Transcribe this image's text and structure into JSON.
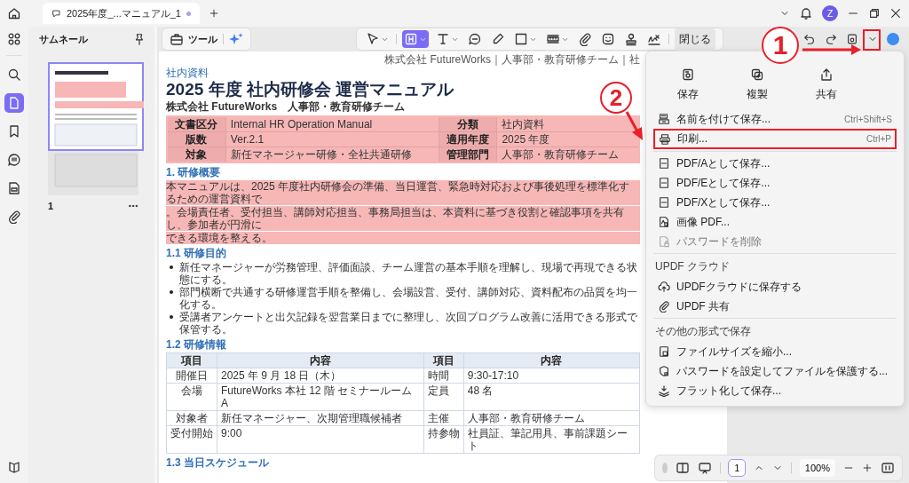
{
  "tab": {
    "title": "2025年度_...マニュアル_1",
    "modified": true
  },
  "account": {
    "initial": "Z"
  },
  "rail": [
    {
      "selected": false
    },
    {
      "selected": true
    },
    {
      "selected": false
    },
    {
      "selected": false
    },
    {
      "selected": false
    },
    {
      "selected": false
    }
  ],
  "thumbnails": {
    "title": "サムネール",
    "pages": [
      {
        "number": "1",
        "selected": true
      }
    ]
  },
  "tools_button": {
    "label": "ツール"
  },
  "toolbar": {
    "tools": [
      {
        "selected": false,
        "dropdown": true
      },
      {
        "selected": true,
        "dropdown": true
      },
      {
        "selected": false,
        "dropdown": true
      },
      {
        "selected": false,
        "dropdown": false
      },
      {
        "selected": false,
        "dropdown": false
      },
      {
        "selected": false,
        "dropdown": true
      },
      {
        "selected": false,
        "dropdown": true
      },
      {
        "selected": false,
        "dropdown": false
      },
      {
        "selected": false,
        "dropdown": false
      },
      {
        "selected": false,
        "dropdown": false
      },
      {
        "selected": false,
        "dropdown": false
      }
    ],
    "close_label": "閉じる"
  },
  "document": {
    "header": "株式会社 FutureWorks｜人事部・教育研修チーム｜社",
    "label": "社内資料",
    "title": "2025 年度 社内研修会 運営マニュアル",
    "org": "株式会社 FutureWorks　人事部・教育研修チーム",
    "meta_rows": [
      [
        "文書区分",
        "Internal HR Operation Manual",
        "分類",
        "社内資料"
      ],
      [
        "版数",
        "Ver.2.1",
        "適用年度",
        "2025 年度"
      ],
      [
        "対象",
        "新任マネージャー研修・全社共通研修",
        "管理部門",
        "人事部・教育研修チーム"
      ]
    ],
    "overview": {
      "heading": "1. 研修概要",
      "highlighted": true,
      "lines": [
        "本マニュアルは、2025 年度社内研修会の準備、当日運営、緊急時対応および事後処理を標準化するための運営資料で",
        "。会場責任者、受付担当、講師対応担当、事務局担当は、本資料に基づき役割と確認事項を共有し、参加者が円滑に",
        "できる環境を整える。"
      ]
    },
    "purpose": {
      "heading": "1.1 研修目的",
      "bullets": [
        "新任マネージャーが労務管理、評価面談、チーム運営の基本手順を理解し、現場で再現できる状態にする。",
        "部門横断で共通する研修運営手順を整備し、会場設営、受付、講師対応、資料配布の品質を均一化する。",
        "受講者アンケートと出欠記録を翌営業日までに整理し、次回プログラム改善に活用できる形式で保管する。"
      ]
    },
    "info": {
      "heading": "1.2 研修情報",
      "columns": [
        "項目",
        "内容",
        "項目",
        "内容"
      ],
      "rows": [
        [
          "開催日",
          "2025 年 9 月 18 日（木）",
          "時間",
          "9:30-17:10"
        ],
        [
          "会場",
          "FutureWorks 本社 12 階 セミナールーム A",
          "定員",
          "48 名"
        ],
        [
          "対象者",
          "新任マネージャー、次期管理職候補者",
          "主催",
          "人事部・教育研修チーム"
        ],
        [
          "受付開始",
          "9:00",
          "持参物",
          "社員証、筆記用具、事前課題シート"
        ]
      ]
    },
    "schedule": {
      "heading": "1.3 当日スケジュール"
    }
  },
  "menu": {
    "quick_actions": [
      {
        "label": "保存"
      },
      {
        "label": "複製"
      },
      {
        "label": "共有"
      }
    ],
    "sections": [
      {
        "items": [
          {
            "label": "名前を付けて保存...",
            "shortcut": "Ctrl+Shift+S",
            "disabled": false,
            "marked": false
          },
          {
            "label": "印刷...",
            "shortcut": "Ctrl+P",
            "disabled": false,
            "marked": true
          }
        ]
      },
      {
        "items": [
          {
            "label": "PDF/Aとして保存...",
            "disabled": false,
            "marked": false
          },
          {
            "label": "PDF/Eとして保存...",
            "disabled": false,
            "marked": false
          },
          {
            "label": "PDF/Xとして保存...",
            "disabled": false,
            "marked": false
          },
          {
            "label": "画像 PDF...",
            "disabled": false,
            "marked": false
          },
          {
            "label": "パスワードを削除",
            "disabled": true,
            "marked": false
          }
        ]
      },
      {
        "heading": "UPDF クラウド",
        "items": [
          {
            "label": "UPDFクラウドに保存する",
            "disabled": false,
            "marked": false
          },
          {
            "label": "UPDF 共有",
            "disabled": false,
            "marked": false
          }
        ]
      },
      {
        "heading": "その他の形式で保存",
        "items": [
          {
            "label": "ファイルサイズを縮小...",
            "disabled": false,
            "marked": false
          },
          {
            "label": "パスワードを設定してファイルを保護する...",
            "disabled": false,
            "marked": false
          },
          {
            "label": "フラット化して保存...",
            "disabled": false,
            "marked": false
          }
        ]
      }
    ]
  },
  "page_nav": {
    "page": "1",
    "zoom": "100%"
  },
  "annotations": [
    {
      "number": "1"
    },
    {
      "number": "2"
    }
  ]
}
